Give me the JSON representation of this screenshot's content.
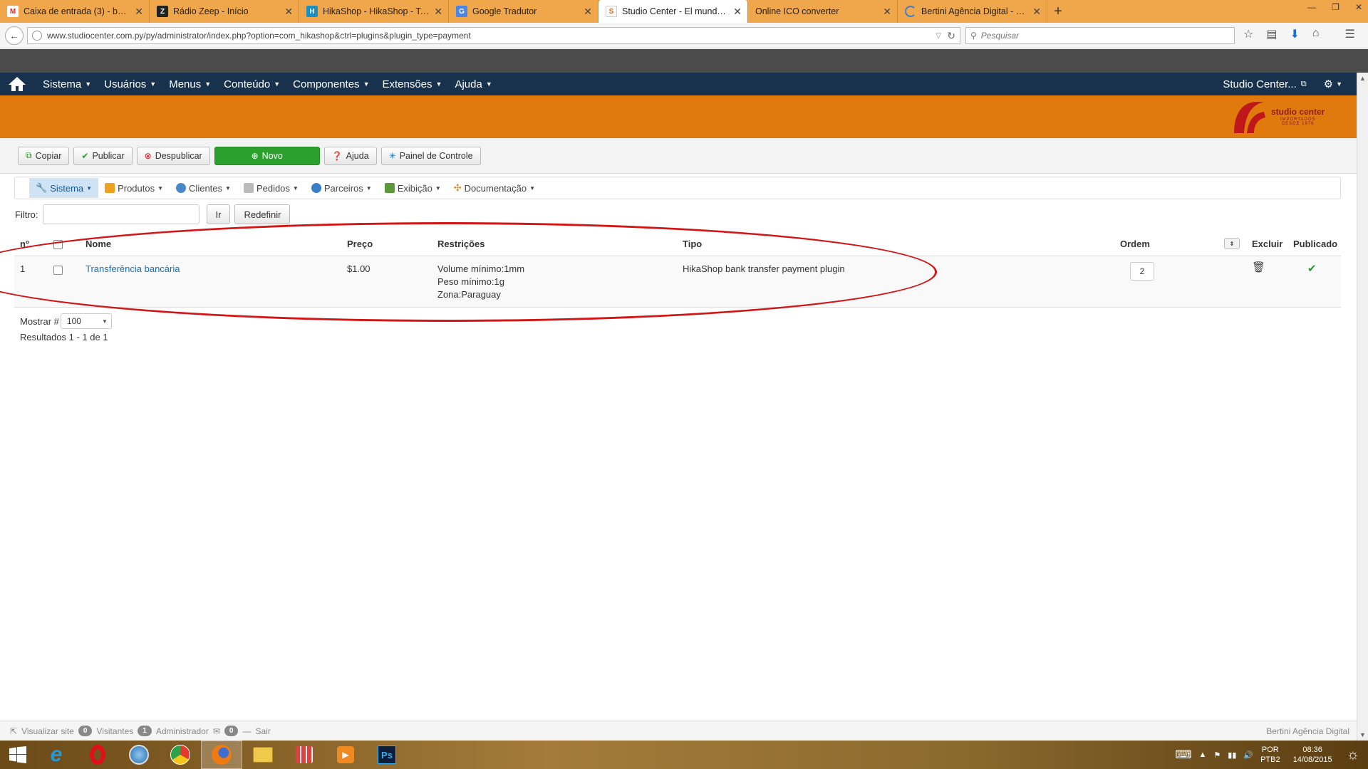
{
  "browser": {
    "tabs": [
      {
        "title": "Caixa de entrada (3) - berti...",
        "favicon": "gmail-icon",
        "color": "#d93025",
        "glyph": "M"
      },
      {
        "title": "Rádio Zeep - Início",
        "favicon": "radio-icon",
        "color": "#222222",
        "glyph": "Z"
      },
      {
        "title": "HikaShop - HikaShop - To...",
        "favicon": "hikashop-icon",
        "color": "#1b8ec2",
        "glyph": "H"
      },
      {
        "title": "Google Tradutor",
        "favicon": "translate-icon",
        "color": "#4a86e8",
        "glyph": "G"
      },
      {
        "title": "Studio Center - El mundo ...",
        "favicon": "studio-icon",
        "color": "#d4630e",
        "glyph": "S",
        "active": true
      },
      {
        "title": "Online ICO converter",
        "favicon": "ico-icon",
        "color": "#999999",
        "glyph": ""
      },
      {
        "title": "Bertini Agência Digital - O...",
        "favicon": "loading-icon",
        "color": "#3a7fc6",
        "glyph": ""
      }
    ],
    "url": "www.studiocenter.com.py/py/administrator/index.php?option=com_hikashop&ctrl=plugins&plugin_type=payment",
    "search_placeholder": "Pesquisar"
  },
  "adminnav": {
    "menus": [
      "Sistema",
      "Usuários",
      "Menus",
      "Conteúdo",
      "Componentes",
      "Extensões",
      "Ajuda"
    ],
    "site_name": "Studio Center..."
  },
  "logo": {
    "line1": "studio center",
    "line2": "IMPORTADOS",
    "line3": "DESDE 1976"
  },
  "toolbar": {
    "copy": "Copiar",
    "publish": "Publicar",
    "unpublish": "Despublicar",
    "new": "Novo",
    "help": "Ajuda",
    "control_panel": "Painel de Controle"
  },
  "hikamenu": {
    "items": [
      "Sistema",
      "Produtos",
      "Clientes",
      "Pedidos",
      "Parceiros",
      "Exibição",
      "Documentação"
    ]
  },
  "filter": {
    "label": "Filtro:",
    "go": "Ir",
    "reset": "Redefinir",
    "value": ""
  },
  "table": {
    "headers": {
      "num": "nº.",
      "name": "Nome",
      "price": "Preço",
      "restrictions": "Restrições",
      "type": "Tipo",
      "order": "Ordem",
      "delete": "Excluir",
      "published": "Publicado"
    },
    "rows": [
      {
        "num": "1",
        "name": "Transferência bancária",
        "price": "$1.00",
        "restriction_1": "Volume mínimo:1mm",
        "restriction_2": "Peso mínimo:1g",
        "restriction_3": "Zona:Paraguay",
        "type": "HikaShop bank transfer payment plugin",
        "order": "2"
      }
    ]
  },
  "pagination": {
    "show_label": "Mostrar #",
    "show_value": "100",
    "results": "Resultados 1 - 1 de 1"
  },
  "status": {
    "view_site": "Visualizar site",
    "visitors_count": "0",
    "visitors": "Visitantes",
    "admin_count": "1",
    "admin": "Administrador",
    "logout_count": "0",
    "logout": "Sair",
    "credit": "Bertini Agência Digital"
  },
  "tray": {
    "lang": "POR",
    "layout": "PTB2",
    "time": "08:36",
    "date": "14/08/2015"
  },
  "colors": {
    "accent_orange": "#e07a0c",
    "nav_dark": "#18324d",
    "link": "#1a6fb3",
    "new_green": "#2ca02c",
    "annotation_red": "#d21616"
  }
}
